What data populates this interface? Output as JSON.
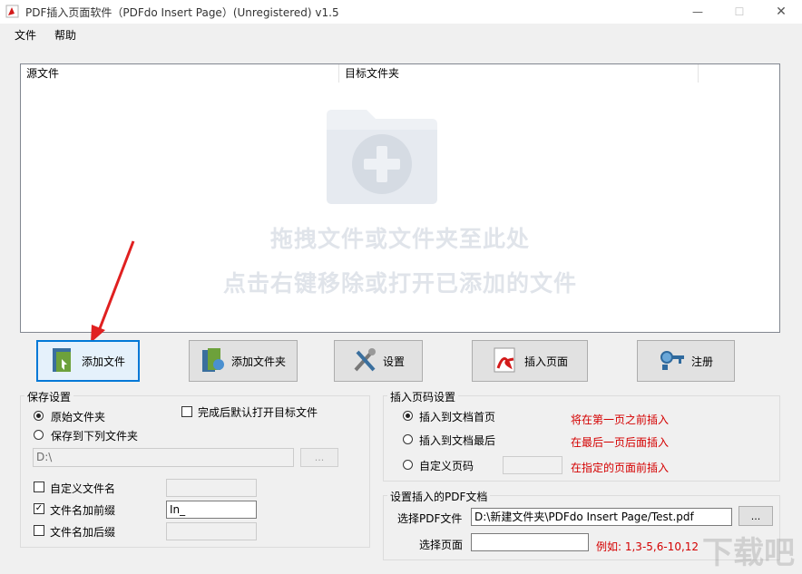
{
  "window": {
    "title": "PDF插入页面软件（PDFdo Insert Page）(Unregistered) v1.5",
    "minimize": "—",
    "maximize": "☐",
    "close": "✕"
  },
  "menu": {
    "file": "文件",
    "help": "帮助"
  },
  "list": {
    "col_source": "源文件",
    "col_target": "目标文件夹",
    "hint1": "拖拽文件或文件夹至此处",
    "hint2": "点击右键移除或打开已添加的文件"
  },
  "toolbar": {
    "add_file": "添加文件",
    "add_folder": "添加文件夹",
    "settings": "设置",
    "insert_page": "插入页面",
    "register": "注册"
  },
  "save_settings": {
    "title": "保存设置",
    "original_folder": "原始文件夹",
    "save_to_folder": "保存到下列文件夹",
    "open_after": "完成后默认打开目标文件",
    "folder_path": "D:\\",
    "browse": "...",
    "custom_name": "自定义文件名",
    "prefix": "文件名加前缀",
    "prefix_value": "In_",
    "suffix": "文件名加后缀"
  },
  "insert_settings": {
    "title": "插入页码设置",
    "first": "插入到文档首页",
    "first_note": "将在第一页之前插入",
    "last": "插入到文档最后",
    "last_note": "在最后一页后面插入",
    "custom": "自定义页码",
    "custom_note": "在指定的页面前插入"
  },
  "pdf_settings": {
    "title": "设置插入的PDF文档",
    "select_pdf": "选择PDF文件",
    "pdf_path": "D:\\新建文件夹\\PDFdo Insert Page/Test.pdf",
    "browse": "...",
    "select_page": "选择页面",
    "example": "例如: 1,3-5,6-10,12"
  },
  "watermark": "下载吧",
  "colors": {
    "accent": "#0078d7",
    "note_red": "#d40000",
    "hint_gray": "#e0e4ea"
  }
}
